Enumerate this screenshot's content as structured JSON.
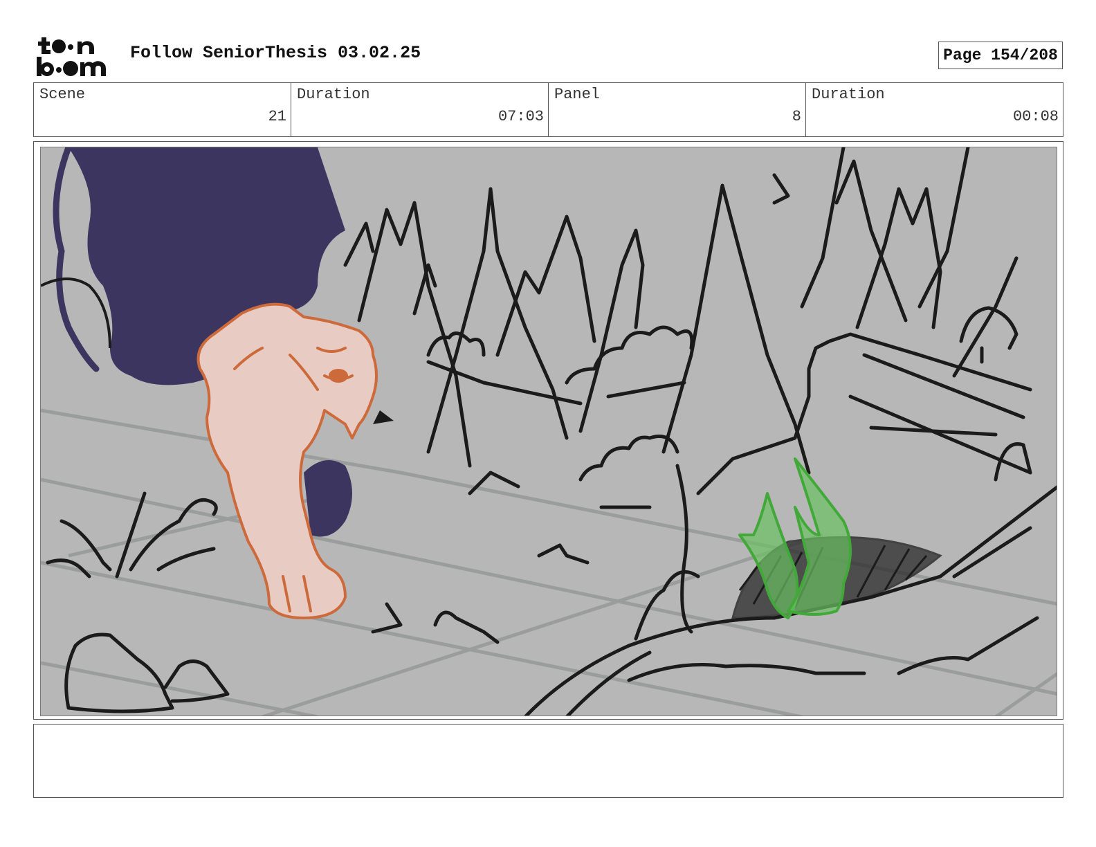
{
  "header": {
    "logo_text": "toonboom",
    "title": "Follow SeniorThesis 03.02.25",
    "page": "Page 154/208"
  },
  "info": [
    {
      "label": "Scene",
      "value": "21"
    },
    {
      "label": "Duration",
      "value": "07:03"
    },
    {
      "label": "Panel",
      "value": "8"
    },
    {
      "label": "Duration",
      "value": "00:08"
    }
  ],
  "panel": {
    "background_color": "#b7b7b7",
    "character_color": "#e8cbc2",
    "character_outline_color": "#cc6a3b",
    "shadow_color": "#3c355f",
    "grass_color": "#5fbf55"
  },
  "notes": {
    "text": ""
  }
}
